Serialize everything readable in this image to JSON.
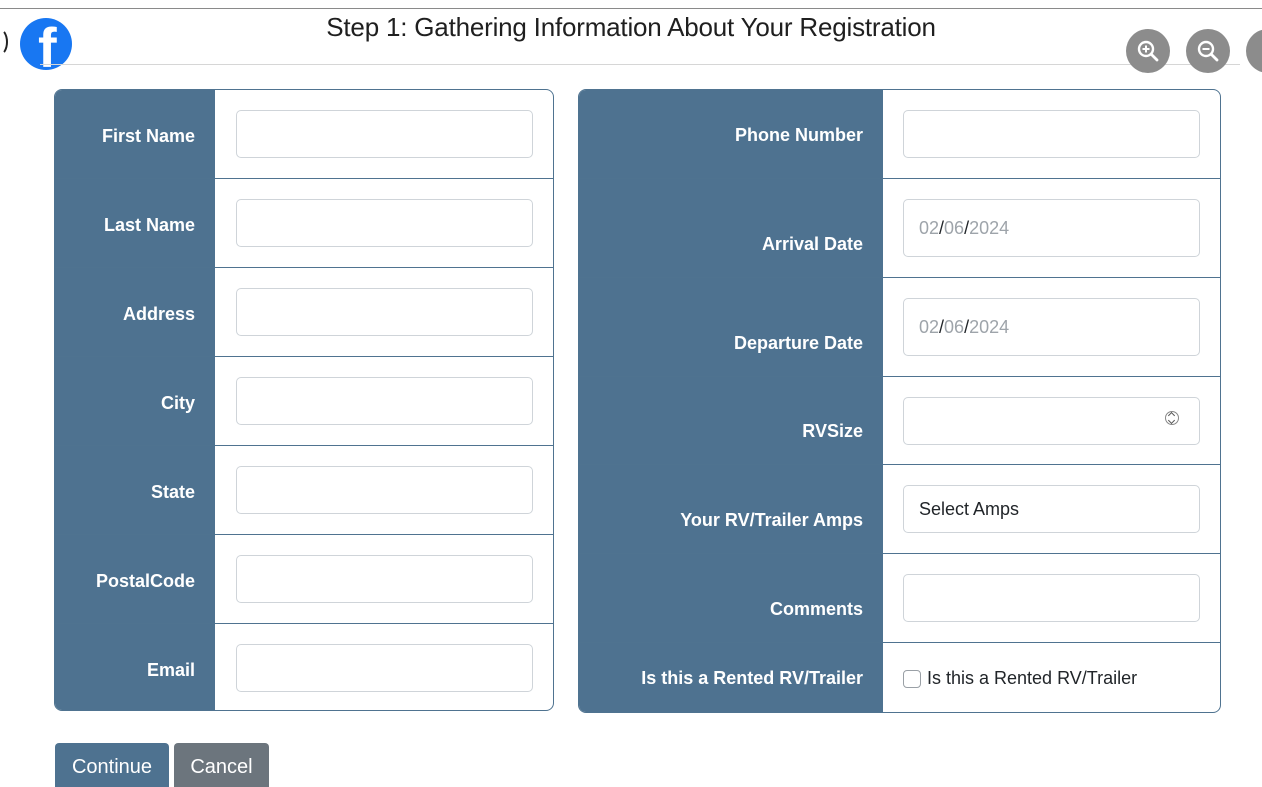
{
  "header": {
    "title": "Step 1: Gathering Information About Your Registration",
    "logo_icon": "facebook-icon",
    "zoom_in_icon": "zoom-in-icon",
    "zoom_out_icon": "zoom-out-icon"
  },
  "colors": {
    "label_bg": "#4e7290",
    "facebook_blue": "#1877f2",
    "cancel_gray": "#6c757d"
  },
  "left_form": {
    "fields": [
      {
        "label": "First Name",
        "value": ""
      },
      {
        "label": "Last Name",
        "value": ""
      },
      {
        "label": "Address",
        "value": ""
      },
      {
        "label": "City",
        "value": ""
      },
      {
        "label": "State",
        "value": ""
      },
      {
        "label": "PostalCode",
        "value": ""
      },
      {
        "label": "Email",
        "value": ""
      }
    ]
  },
  "right_form": {
    "phone": {
      "label": "Phone Number",
      "value": ""
    },
    "arrival": {
      "label": "Arrival Date",
      "month": "02",
      "day": "06",
      "year": "2024",
      "sep": "/"
    },
    "departure": {
      "label": "Departure Date",
      "month": "02",
      "day": "06",
      "year": "2024",
      "sep": "/"
    },
    "rvsize": {
      "label": "RVSize",
      "value": ""
    },
    "amps": {
      "label": "Your RV/Trailer Amps",
      "selected": "Select Amps"
    },
    "comments": {
      "label": "Comments",
      "value": ""
    },
    "rented": {
      "label": "Is this a Rented RV/Trailer",
      "checkbox_label": "Is this a Rented RV/Trailer",
      "checked": false
    }
  },
  "actions": {
    "continue_label": "Continue",
    "cancel_label": "Cancel"
  }
}
